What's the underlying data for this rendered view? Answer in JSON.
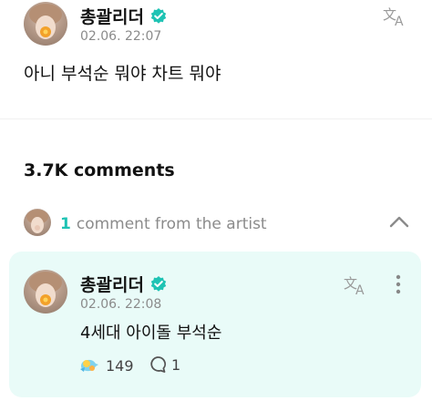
{
  "post": {
    "author": "총괄리더",
    "timestamp": "02.06. 22:07",
    "body": "아니 부석순 뭐야 차트 뭐야"
  },
  "comments": {
    "count_label": "3.7K comments"
  },
  "artist_section": {
    "count": "1",
    "label": "comment from the artist"
  },
  "artist_comment": {
    "author": "총괄리더",
    "timestamp": "02.06. 22:08",
    "body": "4세대 아이돌 부석순",
    "reaction_count": "149",
    "reply_count": "1"
  },
  "colors": {
    "accent": "#1fc3b4",
    "card_background": "#e9fbf8",
    "muted_text": "#8b8b8b"
  },
  "icons": [
    "verified-badge-icon",
    "translate-icon",
    "chevron-up-icon",
    "more-vertical-icon",
    "reaction-icon",
    "reply-bubble-icon"
  ]
}
